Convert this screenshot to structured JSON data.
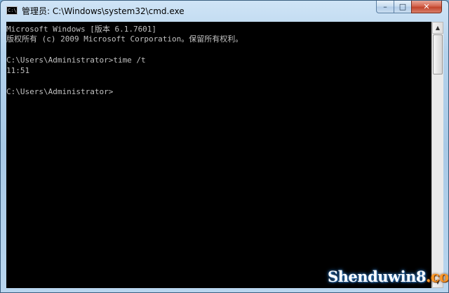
{
  "window": {
    "title": "管理员: C:\\Windows\\system32\\cmd.exe",
    "icon": "cmd-icon",
    "icon_label": "C:\\",
    "controls": {
      "minimize": "–",
      "maximize": "□",
      "close": "✕"
    }
  },
  "console": {
    "lines": [
      "Microsoft Windows [版本 6.1.7601]",
      "版权所有 (c) 2009 Microsoft Corporation。保留所有权利。",
      "",
      "C:\\Users\\Administrator>time /t",
      "11:51",
      "",
      "C:\\Users\\Administrator>"
    ]
  },
  "scrollbar": {
    "up_arrow": "▲",
    "down_arrow": "▼"
  },
  "watermark": {
    "text_main": "Shenduwin8",
    "text_suffix": ".com"
  }
}
